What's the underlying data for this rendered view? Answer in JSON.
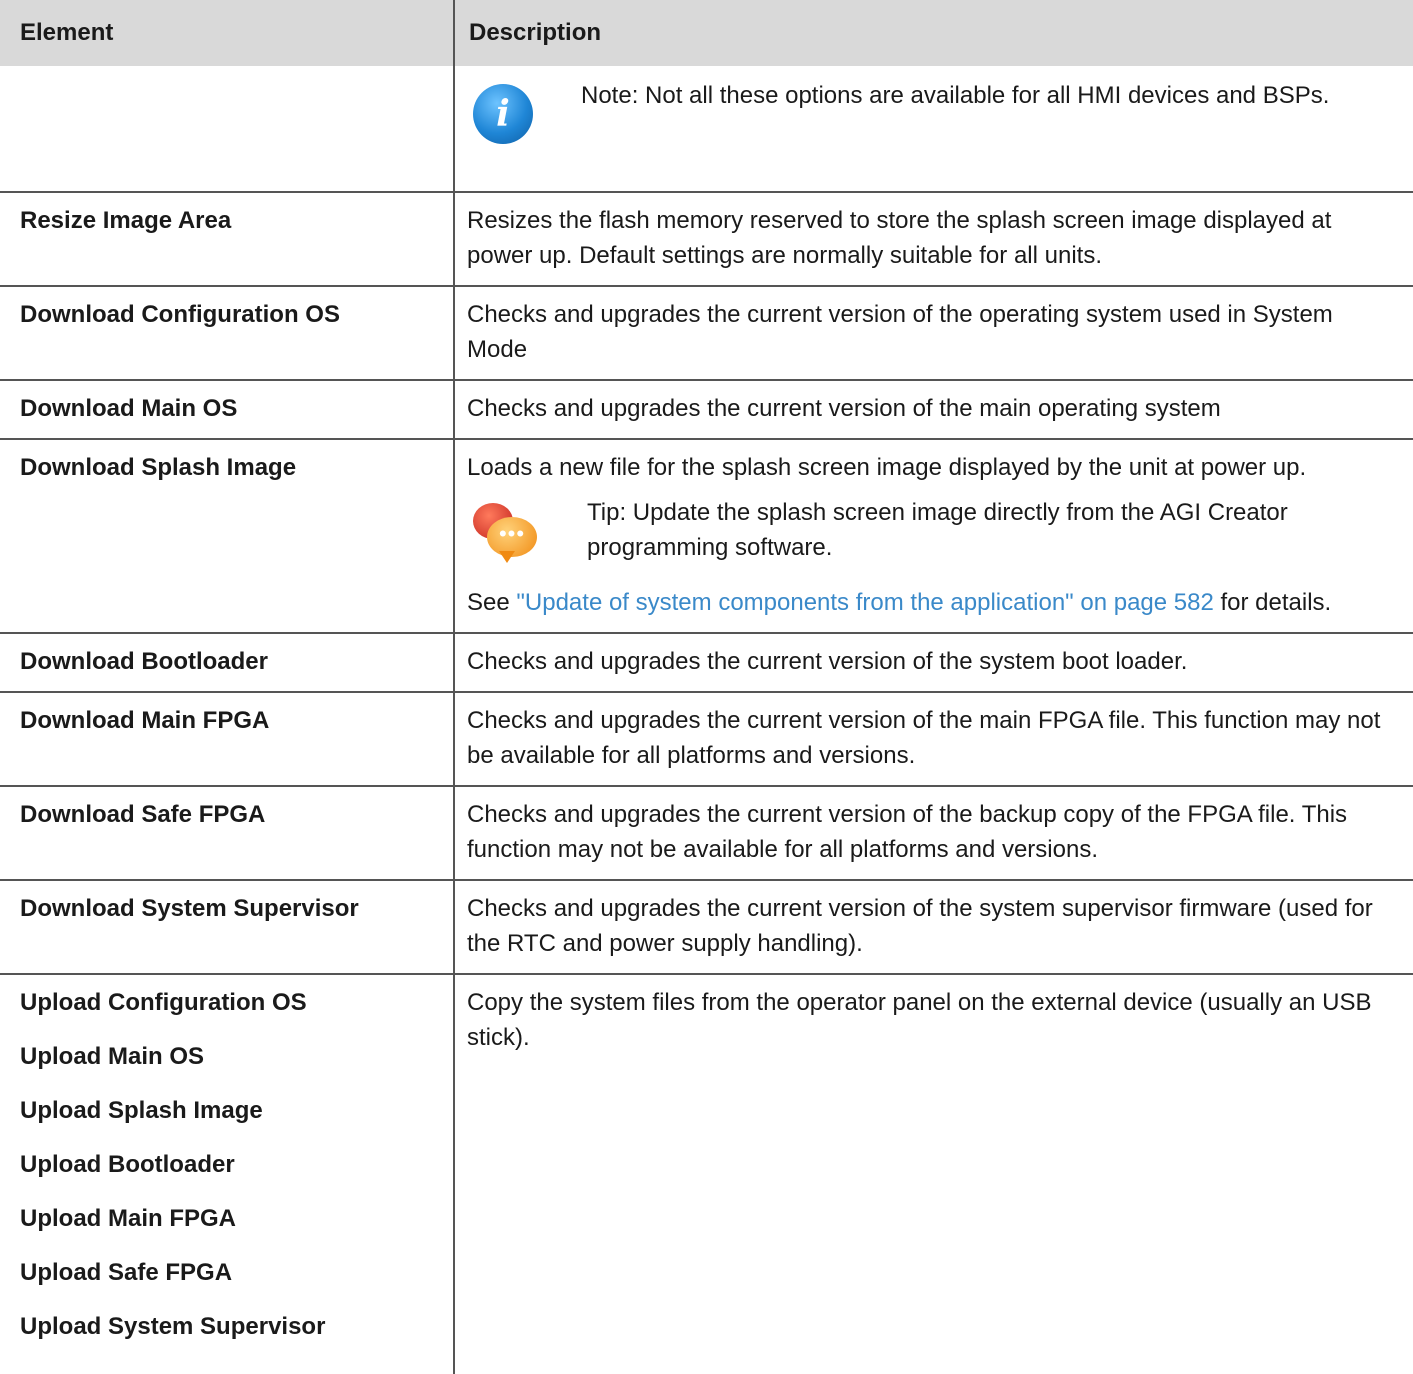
{
  "header": {
    "col_element": "Element",
    "col_description": "Description"
  },
  "note_row": {
    "text": "Note: Not all these options are available for all HMI devices and BSPs.",
    "icon": "info-icon"
  },
  "rows": [
    {
      "element": "Resize Image Area",
      "description": "Resizes the flash memory reserved to store the splash screen image displayed at power up. Default settings are normally suitable for all units."
    },
    {
      "element": "Download Configuration OS",
      "description": "Checks and upgrades the current version of the operating system used in System Mode"
    },
    {
      "element": "Download Main OS",
      "description": "Checks and upgrades the current version of the main operating system"
    }
  ],
  "splash_row": {
    "element": "Download Splash Image",
    "description": "Loads a new file for the splash screen image displayed by the unit at power up.",
    "tip": "Tip: Update the splash screen image directly from the AGI Creator programming software.",
    "see_prefix": "See ",
    "link_text": "\"Update of system components from the application\" on page 582",
    "see_suffix": " for details."
  },
  "rows2": [
    {
      "element": "Download Bootloader",
      "description": "Checks and upgrades the current version of the system boot loader."
    },
    {
      "element": "Download Main FPGA",
      "description": "Checks and upgrades the current version of the main FPGA file. This function may not be available for all platforms and versions."
    },
    {
      "element": "Download Safe FPGA",
      "description": "Checks and upgrades the current version of the backup copy of the FPGA file. This function may not be available for all platforms and versions."
    },
    {
      "element": "Download System Supervisor",
      "description": "Checks and upgrades the current version of the system supervisor firmware (used for the RTC and power supply handling)."
    }
  ],
  "upload_row": {
    "elements": [
      "Upload Configuration OS",
      "Upload Main OS",
      "Upload Splash Image",
      "Upload Bootloader",
      "Upload Main FPGA",
      "Upload Safe FPGA",
      "Upload System Supervisor"
    ],
    "description": "Copy the system files from the operator panel on the external device (usually an USB stick)."
  }
}
